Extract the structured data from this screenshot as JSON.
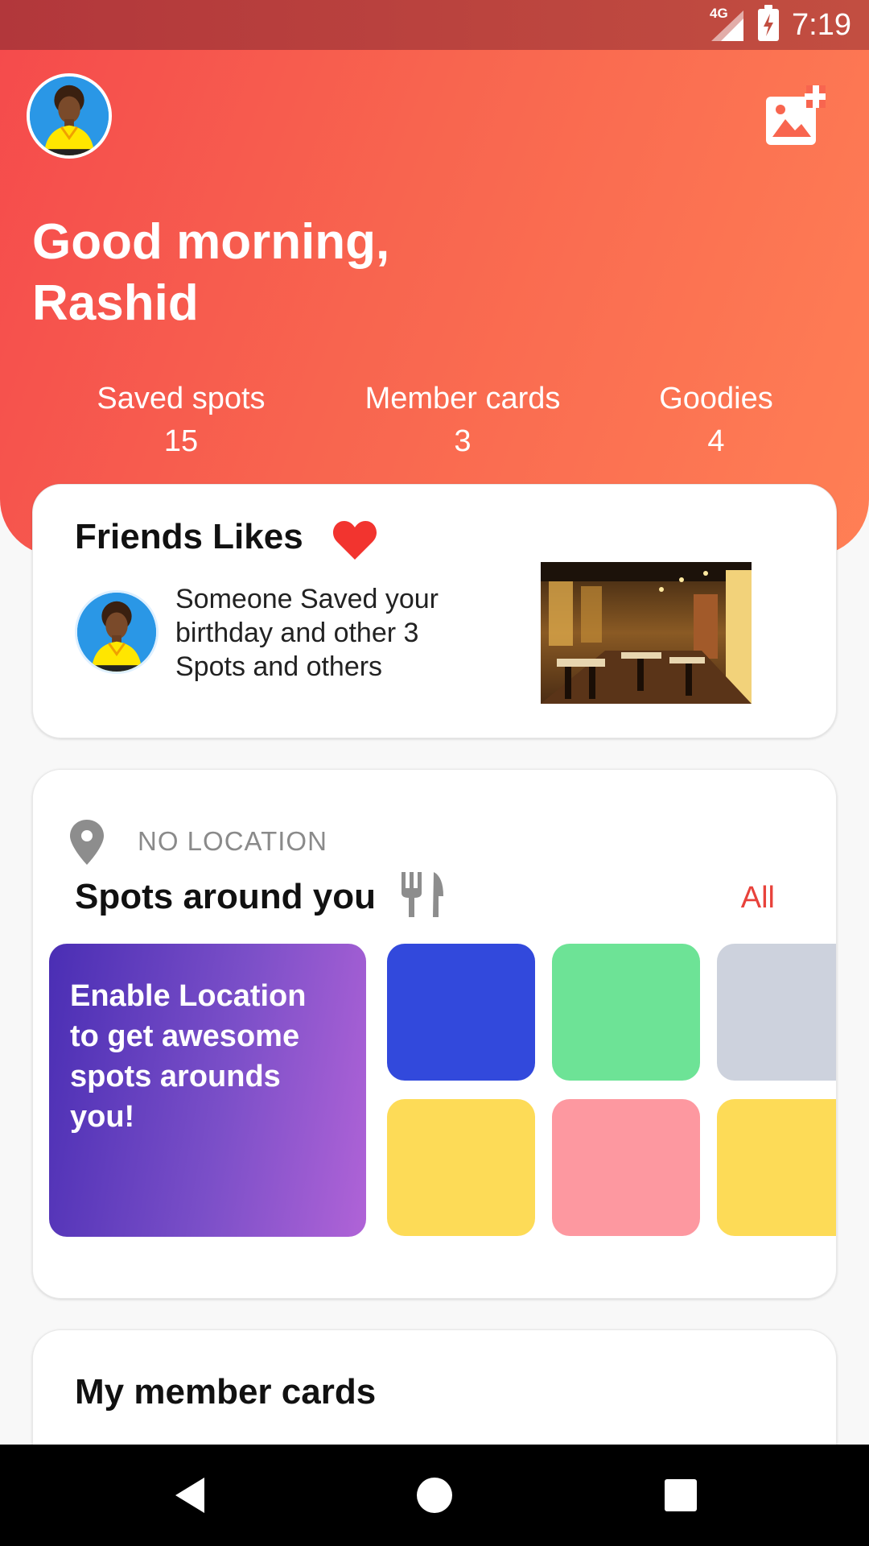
{
  "status_bar": {
    "network": "4G",
    "time": "7:19"
  },
  "header": {
    "greeting": "Good morning,",
    "user_name": "Rashid",
    "colors": {
      "gradient_start": "#f54a4c",
      "gradient_end": "#ff7f55"
    },
    "stats": [
      {
        "label": "Saved spots",
        "value": "15"
      },
      {
        "label": "Member cards",
        "value": "3"
      },
      {
        "label": "Goodies",
        "value": "4"
      }
    ],
    "icons": {
      "avatar": "user-avatar-icon",
      "add_photo": "add-photo-icon"
    }
  },
  "friends_likes": {
    "title": "Friends Likes",
    "text": "Someone Saved your birthday and other 3 Spots and others",
    "icons": {
      "heart": "heart-icon"
    }
  },
  "spots": {
    "location_label": "NO LOCATION",
    "title": "Spots around you",
    "all_label": "All",
    "enable_text": "Enable Location to get awesome spots arounds you!",
    "tile_colors": [
      "#3249dc",
      "#6de396",
      "#cdd2dd",
      "#fddb57",
      "#fd98a0",
      "#fddb57"
    ],
    "icons": {
      "pin": "location-pin-icon",
      "restaurant": "fork-knife-icon"
    }
  },
  "member_cards": {
    "title": "My member cards"
  },
  "nav": {
    "icons": [
      "back-icon",
      "home-icon",
      "recent-apps-icon"
    ]
  }
}
